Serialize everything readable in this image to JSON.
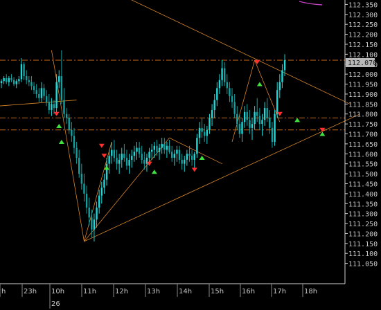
{
  "chart_data": {
    "type": "candlestick",
    "title": "",
    "xlabel": "",
    "ylabel": "",
    "ylim": [
      111.0,
      112.4
    ],
    "y_ticks": [
      "112.350",
      "112.300",
      "112.250",
      "112.200",
      "112.150",
      "112.100",
      "112.050",
      "112.000",
      "111.950",
      "111.900",
      "111.850",
      "111.800",
      "111.750",
      "111.700",
      "111.650",
      "111.600",
      "111.550",
      "111.500",
      "111.450",
      "111.400",
      "111.350",
      "111.300",
      "111.250",
      "111.200",
      "111.150",
      "111.100",
      "111.050"
    ],
    "x_ticks": [
      "h",
      "23h",
      "10h",
      "11h",
      "12h",
      "13h",
      "14h",
      "15h",
      "16h",
      "17h",
      "18h"
    ],
    "date_label": "26",
    "current_price": "112.070",
    "horizontal_levels": [
      112.07,
      111.78,
      111.72
    ],
    "bullish_up": "#1fd8d8",
    "bullish_down": "#14a0a0",
    "candles": [
      [
        111.955,
        111.975,
        111.93,
        111.965
      ],
      [
        111.965,
        111.99,
        111.95,
        111.98
      ],
      [
        111.98,
        112.0,
        111.95,
        111.96
      ],
      [
        111.96,
        111.99,
        111.94,
        111.98
      ],
      [
        111.98,
        112.0,
        111.96,
        111.97
      ],
      [
        111.97,
        111.985,
        111.94,
        111.95
      ],
      [
        111.95,
        111.975,
        111.93,
        111.965
      ],
      [
        111.965,
        111.99,
        111.95,
        111.975
      ],
      [
        111.975,
        112.08,
        111.96,
        112.05
      ],
      [
        112.05,
        112.06,
        111.97,
        111.99
      ],
      [
        111.99,
        112.02,
        111.95,
        111.97
      ],
      [
        111.97,
        111.99,
        111.94,
        111.96
      ],
      [
        111.96,
        111.99,
        111.92,
        111.94
      ],
      [
        111.94,
        111.96,
        111.9,
        111.92
      ],
      [
        111.92,
        111.95,
        111.88,
        111.9
      ],
      [
        111.9,
        111.93,
        111.86,
        111.88
      ],
      [
        111.88,
        111.96,
        111.86,
        111.93
      ],
      [
        111.93,
        111.95,
        111.87,
        111.89
      ],
      [
        111.89,
        111.92,
        111.84,
        111.86
      ],
      [
        111.86,
        111.9,
        111.8,
        111.82
      ],
      [
        111.82,
        111.88,
        111.79,
        111.85
      ],
      [
        111.85,
        111.87,
        111.8,
        111.83
      ],
      [
        111.83,
        112.0,
        111.8,
        111.96
      ],
      [
        111.96,
        112.02,
        111.93,
        111.99
      ],
      [
        111.99,
        112.12,
        111.85,
        111.87
      ],
      [
        111.87,
        111.93,
        111.78,
        111.8
      ],
      [
        111.8,
        111.83,
        111.75,
        111.78
      ],
      [
        111.78,
        111.8,
        111.7,
        111.72
      ],
      [
        111.72,
        111.76,
        111.66,
        111.69
      ],
      [
        111.69,
        111.73,
        111.6,
        111.63
      ],
      [
        111.63,
        111.66,
        111.55,
        111.58
      ],
      [
        111.58,
        111.62,
        111.48,
        111.5
      ],
      [
        111.5,
        111.55,
        111.42,
        111.45
      ],
      [
        111.45,
        111.5,
        111.36,
        111.4
      ],
      [
        111.4,
        111.44,
        111.3,
        111.33
      ],
      [
        111.33,
        111.38,
        111.24,
        111.28
      ],
      [
        111.28,
        111.32,
        111.18,
        111.22
      ],
      [
        111.22,
        111.3,
        111.16,
        111.27
      ],
      [
        111.27,
        111.36,
        111.23,
        111.33
      ],
      [
        111.33,
        111.42,
        111.3,
        111.39
      ],
      [
        111.39,
        111.46,
        111.35,
        111.43
      ],
      [
        111.43,
        111.5,
        111.4,
        111.47
      ],
      [
        111.47,
        111.58,
        111.44,
        111.55
      ],
      [
        111.55,
        111.62,
        111.5,
        111.59
      ],
      [
        111.59,
        111.66,
        111.55,
        111.62
      ],
      [
        111.62,
        111.67,
        111.56,
        111.58
      ],
      [
        111.58,
        111.62,
        111.52,
        111.55
      ],
      [
        111.55,
        111.6,
        111.5,
        111.57
      ],
      [
        111.57,
        111.63,
        111.53,
        111.6
      ],
      [
        111.6,
        111.65,
        111.56,
        111.58
      ],
      [
        111.58,
        111.62,
        111.52,
        111.54
      ],
      [
        111.54,
        111.6,
        111.5,
        111.57
      ],
      [
        111.57,
        111.62,
        111.53,
        111.59
      ],
      [
        111.59,
        111.64,
        111.56,
        111.61
      ],
      [
        111.61,
        111.66,
        111.57,
        111.63
      ],
      [
        111.63,
        111.66,
        111.58,
        111.6
      ],
      [
        111.6,
        111.64,
        111.55,
        111.57
      ],
      [
        111.57,
        111.61,
        111.52,
        111.55
      ],
      [
        111.55,
        111.6,
        111.51,
        111.58
      ],
      [
        111.58,
        111.63,
        111.54,
        111.61
      ],
      [
        111.61,
        111.65,
        111.57,
        111.62
      ],
      [
        111.62,
        111.66,
        111.58,
        111.64
      ],
      [
        111.64,
        111.67,
        111.59,
        111.61
      ],
      [
        111.61,
        111.65,
        111.57,
        111.63
      ],
      [
        111.63,
        111.68,
        111.6,
        111.65
      ],
      [
        111.65,
        111.68,
        111.6,
        111.62
      ],
      [
        111.62,
        111.66,
        111.58,
        111.64
      ],
      [
        111.64,
        111.67,
        111.6,
        111.61
      ],
      [
        111.61,
        111.64,
        111.56,
        111.58
      ],
      [
        111.58,
        111.62,
        111.54,
        111.6
      ],
      [
        111.6,
        111.64,
        111.56,
        111.62
      ],
      [
        111.62,
        111.64,
        111.55,
        111.57
      ],
      [
        111.57,
        111.6,
        111.52,
        111.55
      ],
      [
        111.55,
        111.59,
        111.51,
        111.57
      ],
      [
        111.57,
        111.62,
        111.54,
        111.6
      ],
      [
        111.6,
        111.64,
        111.56,
        111.59
      ],
      [
        111.59,
        111.62,
        111.54,
        111.57
      ],
      [
        111.57,
        111.61,
        111.53,
        111.6
      ],
      [
        111.6,
        111.7,
        111.58,
        111.68
      ],
      [
        111.68,
        111.76,
        111.65,
        111.73
      ],
      [
        111.73,
        111.78,
        111.68,
        111.71
      ],
      [
        111.71,
        111.75,
        111.66,
        111.69
      ],
      [
        111.69,
        111.74,
        111.65,
        111.72
      ],
      [
        111.72,
        111.8,
        111.7,
        111.78
      ],
      [
        111.78,
        111.85,
        111.74,
        111.82
      ],
      [
        111.82,
        111.9,
        111.78,
        111.87
      ],
      [
        111.87,
        111.96,
        111.84,
        111.93
      ],
      [
        111.93,
        112.0,
        111.9,
        111.97
      ],
      [
        111.97,
        112.07,
        111.94,
        112.03
      ],
      [
        112.03,
        112.06,
        111.94,
        111.96
      ],
      [
        111.96,
        112.0,
        111.9,
        111.93
      ],
      [
        111.93,
        111.96,
        111.86,
        111.89
      ],
      [
        111.89,
        111.93,
        111.83,
        111.86
      ],
      [
        111.86,
        111.9,
        111.78,
        111.8
      ],
      [
        111.8,
        111.84,
        111.72,
        111.75
      ],
      [
        111.75,
        111.8,
        111.68,
        111.7
      ],
      [
        111.7,
        111.78,
        111.66,
        111.76
      ],
      [
        111.76,
        111.84,
        111.73,
        111.81
      ],
      [
        111.81,
        111.85,
        111.74,
        111.77
      ],
      [
        111.77,
        111.82,
        111.7,
        111.73
      ],
      [
        111.73,
        111.78,
        111.67,
        111.75
      ],
      [
        111.75,
        111.84,
        111.72,
        111.81
      ],
      [
        111.81,
        111.88,
        111.76,
        111.79
      ],
      [
        111.79,
        111.83,
        111.72,
        111.75
      ],
      [
        111.75,
        111.8,
        111.69,
        111.77
      ],
      [
        111.77,
        111.86,
        111.74,
        111.83
      ],
      [
        111.83,
        111.88,
        111.76,
        111.78
      ],
      [
        111.78,
        111.82,
        111.7,
        111.73
      ],
      [
        111.73,
        111.76,
        111.63,
        111.66
      ],
      [
        111.66,
        111.82,
        111.64,
        111.8
      ],
      [
        111.8,
        111.96,
        111.78,
        111.92
      ],
      [
        111.92,
        112.0,
        111.88,
        111.96
      ],
      [
        111.96,
        112.05,
        111.93,
        112.02
      ],
      [
        112.02,
        112.1,
        111.99,
        112.07
      ]
    ]
  },
  "markers": [
    {
      "type": "down",
      "i": 22,
      "price": 111.8
    },
    {
      "type": "up",
      "i": 23,
      "price": 111.74
    },
    {
      "type": "up",
      "i": 24,
      "price": 111.66
    },
    {
      "type": "down",
      "i": 40,
      "price": 111.64
    },
    {
      "type": "down",
      "i": 41,
      "price": 111.59
    },
    {
      "type": "up",
      "i": 42,
      "price": 111.53
    },
    {
      "type": "down",
      "i": 59,
      "price": 111.55
    },
    {
      "type": "up",
      "i": 61,
      "price": 111.51
    },
    {
      "type": "down",
      "i": 77,
      "price": 111.52
    },
    {
      "type": "up",
      "i": 80,
      "price": 111.58
    },
    {
      "type": "down",
      "i": 102,
      "price": 112.06
    },
    {
      "type": "up",
      "i": 103,
      "price": 111.95
    },
    {
      "type": "down",
      "i": 111,
      "price": 111.8
    },
    {
      "type": "up",
      "i": 118,
      "price": 111.77
    },
    {
      "type": "down",
      "i": 128,
      "price": 111.72
    },
    {
      "type": "up",
      "i": 128,
      "price": 111.7
    }
  ],
  "lines": [
    [
      [
        -1,
        111.84
      ],
      [
        30,
        111.87
      ]
    ],
    [
      [
        20,
        112.12
      ],
      [
        33,
        111.16
      ]
    ],
    [
      [
        33,
        111.16
      ],
      [
        44,
        111.66
      ]
    ],
    [
      [
        33,
        111.16
      ],
      [
        67,
        111.68
      ]
    ],
    [
      [
        33,
        111.16
      ],
      [
        143,
        111.8
      ]
    ],
    [
      [
        67,
        111.68
      ],
      [
        88,
        111.55
      ]
    ],
    [
      [
        39,
        112.45
      ],
      [
        139,
        111.85
      ]
    ],
    [
      [
        101,
        112.07
      ],
      [
        111,
        111.76
      ]
    ],
    [
      [
        101,
        112.07
      ],
      [
        92,
        111.66
      ]
    ]
  ],
  "indicator_color": "#c040c0",
  "level_color": "#c86a1a"
}
